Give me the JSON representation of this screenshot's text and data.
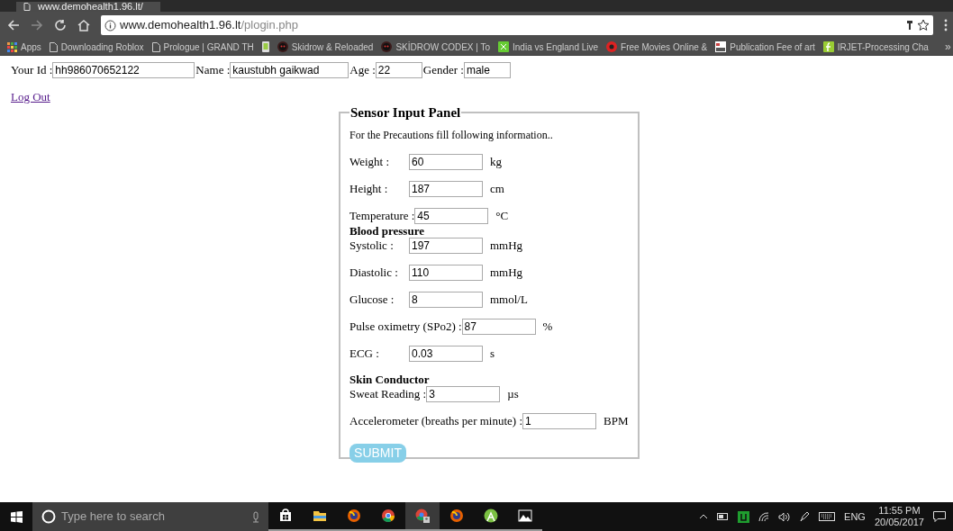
{
  "browser": {
    "tab_title": "www.demohealth1.96.lt/",
    "url_host": "www.demohealth1.96.lt",
    "url_path": "/plogin.php",
    "bookmarks": [
      {
        "kind": "apps",
        "label": "Apps"
      },
      {
        "kind": "page",
        "label": "Downloading Roblox"
      },
      {
        "kind": "page",
        "label": "Prologue | GRAND TH"
      },
      {
        "kind": "phone"
      },
      {
        "kind": "skull",
        "label": "Skidrow & Reloaded"
      },
      {
        "kind": "skull",
        "label": "SKİDROW CODEX | To"
      },
      {
        "kind": "green",
        "label": "India vs England Live"
      },
      {
        "kind": "red",
        "label": "Free Movies Online &"
      },
      {
        "kind": "doc",
        "label": "Publication Fee of art"
      },
      {
        "kind": "leaf",
        "label": "IRJET-Processing Cha"
      }
    ],
    "overflow": "»"
  },
  "user_fields": [
    {
      "label": "Your Id :",
      "value": "hh986070652122"
    },
    {
      "label": "Name :",
      "value": "kaustubh gaikwad"
    },
    {
      "label": "Age :",
      "value": "22"
    },
    {
      "label": "Gender :",
      "value": "male"
    }
  ],
  "logout": "Log Out",
  "panel": {
    "title": "Sensor Input Panel",
    "intro": "For the Precautions fill following information..",
    "items": [
      {
        "kind": "field",
        "label": "Weight :",
        "value": "60",
        "unit": "kg"
      },
      {
        "kind": "field",
        "label": "Height :",
        "value": "187",
        "unit": "cm"
      },
      {
        "kind": "field",
        "label": "Temperature :",
        "value": "45",
        "unit": "°C"
      },
      {
        "kind": "heading",
        "label": "Blood pressure"
      },
      {
        "kind": "field",
        "label": "Systolic :",
        "value": "197",
        "unit": "mmHg"
      },
      {
        "kind": "field",
        "label": "Diastolic :",
        "value": "110",
        "unit": "mmHg"
      },
      {
        "kind": "field",
        "label": "Glucose :",
        "value": "8",
        "unit": "mmol/L"
      },
      {
        "kind": "field",
        "label": "Pulse oximetry (SPo2) :",
        "value": "87",
        "unit": "%"
      },
      {
        "kind": "field",
        "label": "ECG :",
        "value": "0.03",
        "unit": "s"
      },
      {
        "kind": "heading",
        "label": "Skin Conductor"
      },
      {
        "kind": "field",
        "label": "Sweat Reading :",
        "value": "3",
        "unit": "µs"
      },
      {
        "kind": "field",
        "label": "Accelerometer (breaths per minute) :",
        "value": "1",
        "unit": "BPM"
      }
    ],
    "submit": "SUBMIT"
  },
  "taskbar": {
    "search_placeholder": "Type here to search",
    "apps": [
      {
        "kind": "store"
      },
      {
        "kind": "folder"
      },
      {
        "kind": "firefox"
      },
      {
        "kind": "chrome"
      },
      {
        "kind": "chrome-user",
        "selected": true
      },
      {
        "kind": "firefox"
      },
      {
        "kind": "android"
      },
      {
        "kind": "photos"
      }
    ],
    "language": "ENG",
    "time": "11:55 PM",
    "date": "20/05/2017"
  }
}
